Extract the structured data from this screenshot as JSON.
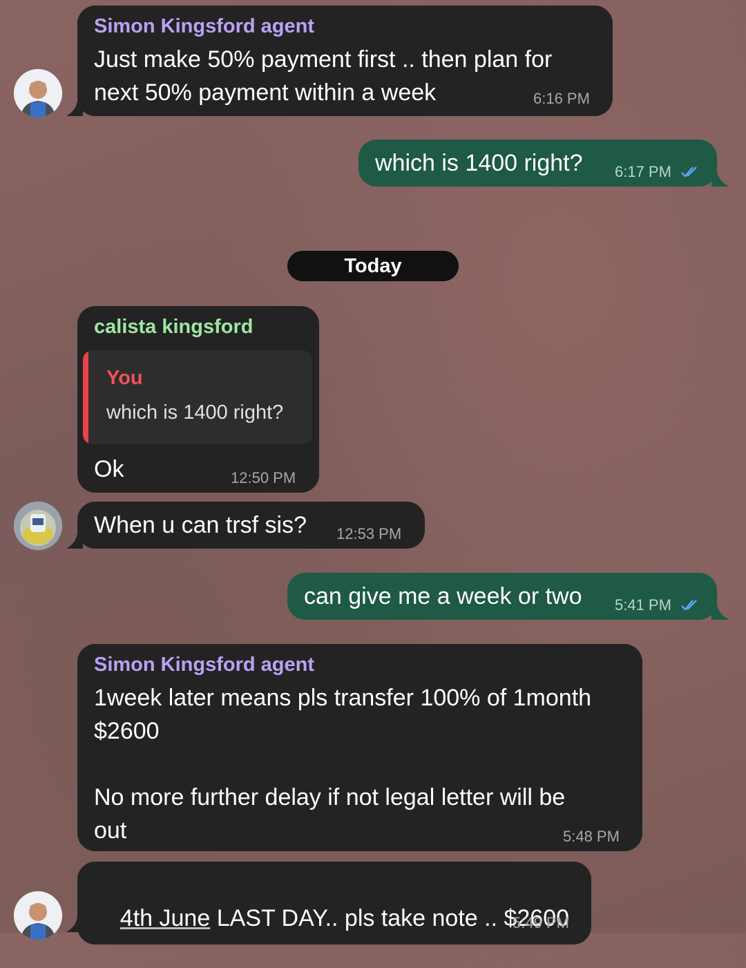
{
  "colors": {
    "incoming_bubble": "#232323",
    "outgoing_bubble": "#1e5a46",
    "sender_simon": "#b9a2f5",
    "sender_calista": "#9ee7a0",
    "quote_accent": "#e8424a",
    "read_check": "#5ea6ff"
  },
  "messages": [
    {
      "sender": "Simon Kingsford agent",
      "text": "Just make 50% payment first .. then plan for\nnext 50% payment within a week",
      "time": "6:16 PM"
    },
    {
      "text": "which is 1400 right?",
      "time": "6:17 PM",
      "status_icon": "double-check-icon"
    },
    {
      "sender": "calista kingsford",
      "quote_author": "You",
      "quote_text": "which is 1400 right?",
      "text": "Ok",
      "time": "12:50 PM"
    },
    {
      "text": "When u can trsf sis?",
      "time": "12:53 PM"
    },
    {
      "text": "can give me a week or two",
      "time": "5:41 PM",
      "status_icon": "double-check-icon"
    },
    {
      "sender": "Simon Kingsford agent",
      "text": "1week later means pls transfer 100% of 1month\n$2600\n\nNo more further delay if not legal letter will be\nout",
      "time": "5:48 PM"
    },
    {
      "text_link": "4th June",
      "text": " LAST DAY.. pls take note .. $2600",
      "time": "5:49 PM"
    }
  ],
  "date_separator": "Today"
}
